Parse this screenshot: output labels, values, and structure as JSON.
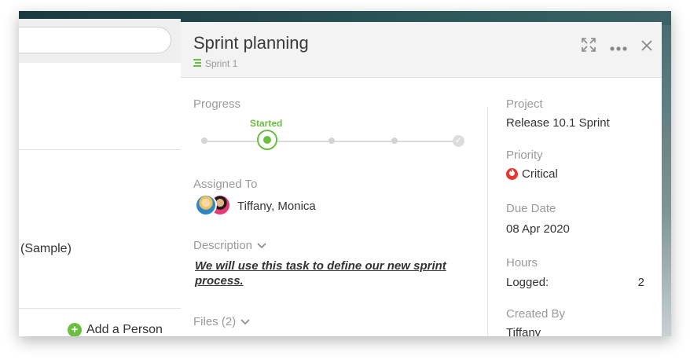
{
  "left_panel": {
    "sample_text": "(Sample)",
    "add_person_label": "Add a Person"
  },
  "task": {
    "title": "Sprint planning",
    "sprint": "Sprint 1",
    "progress_label": "Progress",
    "progress_state": "Started",
    "progress_steps_total": 5,
    "progress_step_current": 2,
    "assigned_label": "Assigned To",
    "assignees": "Tiffany, Monica",
    "description_label": "Description",
    "description_text": "We will use this task to define our new sprint process.",
    "files_label": "Files (2)"
  },
  "details": {
    "project_label": "Project",
    "project_value": "Release 10.1 Sprint",
    "priority_label": "Priority",
    "priority_value": "Critical",
    "due_label": "Due Date",
    "due_value": "08 Apr 2020",
    "hours_label": "Hours",
    "hours_logged_label": "Logged:",
    "hours_logged_value": "2",
    "created_label": "Created By",
    "created_value": "Tiffany"
  },
  "colors": {
    "accent_green": "#6abf3f",
    "critical_red": "#e8352e"
  },
  "icons": [
    "expand-icon",
    "more-icon",
    "close-icon",
    "sprint-list-icon",
    "chevron-down-icon",
    "critical-flame-icon",
    "plus-circle-icon",
    "check-icon"
  ]
}
